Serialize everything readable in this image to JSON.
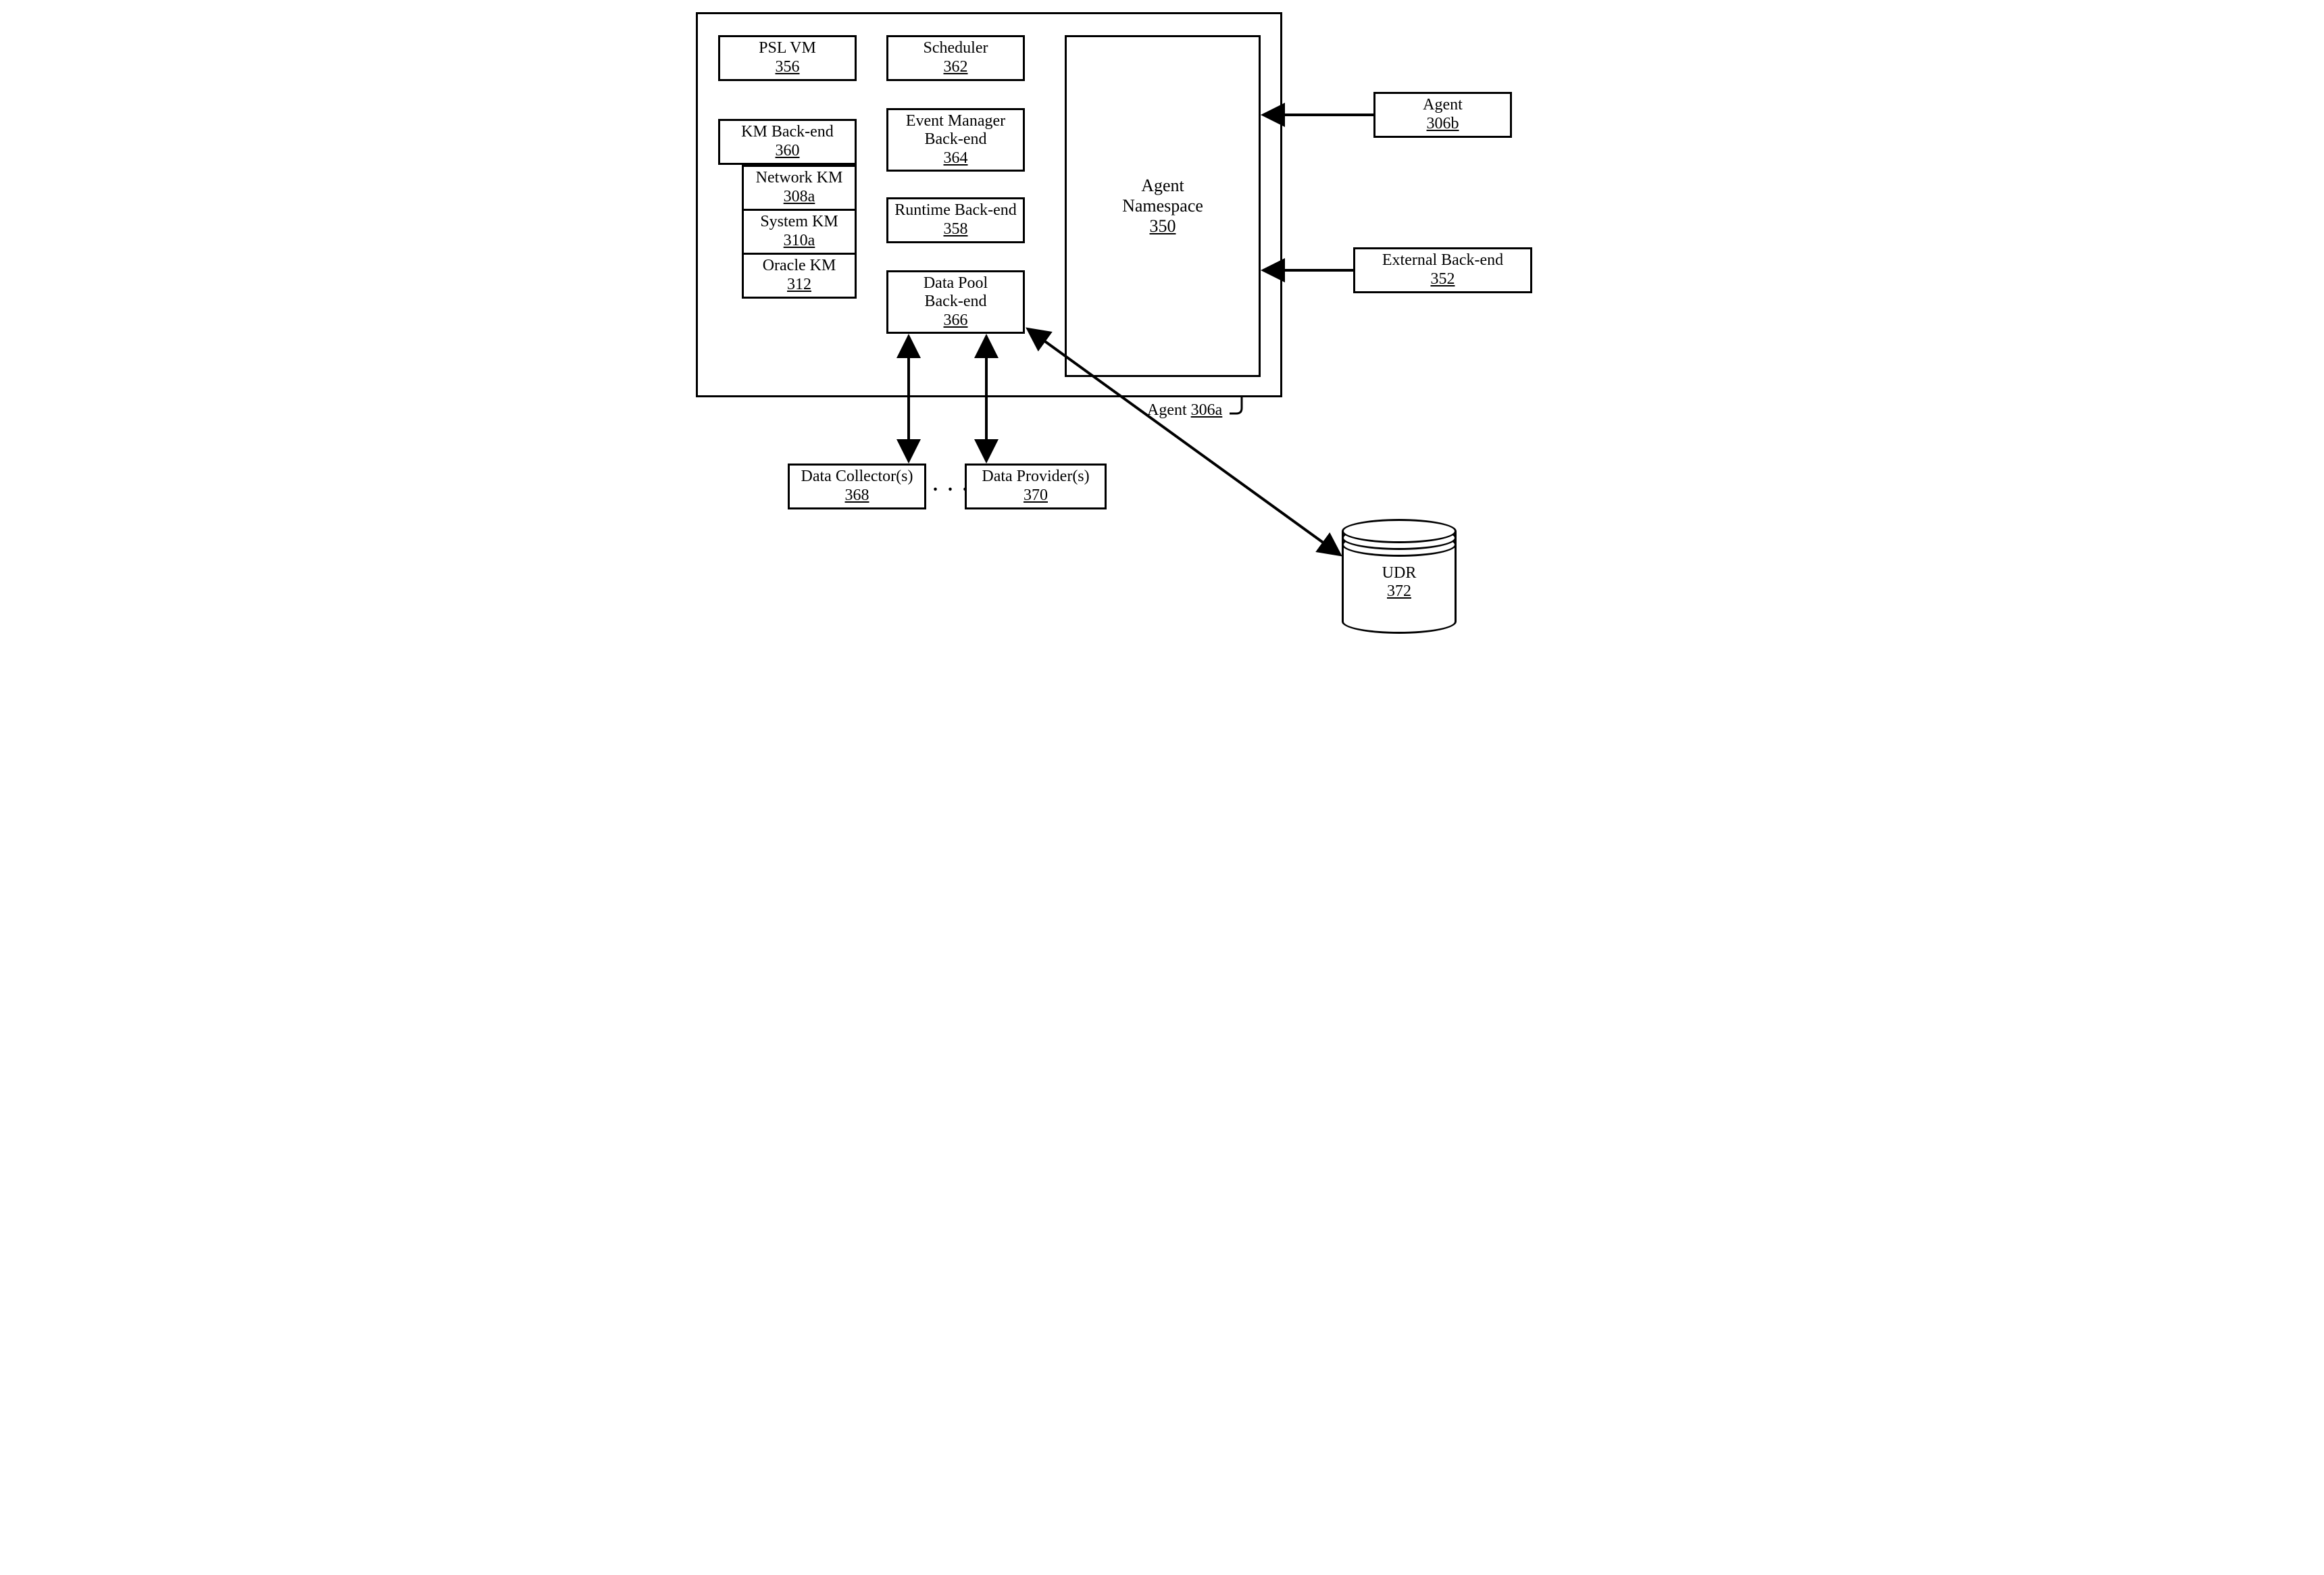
{
  "blocks": {
    "psl_vm": {
      "name": "PSL VM",
      "num": "356"
    },
    "km_backend": {
      "name": "KM Back-end",
      "num": "360"
    },
    "network_km": {
      "name": "Network KM",
      "num": "308a"
    },
    "system_km": {
      "name": "System KM",
      "num": "310a"
    },
    "oracle_km": {
      "name": "Oracle KM",
      "num": "312"
    },
    "scheduler": {
      "name": "Scheduler",
      "num": "362"
    },
    "event_mgr": {
      "name1": "Event Manager",
      "name2": "Back-end",
      "num": "364"
    },
    "runtime": {
      "name": "Runtime Back-end",
      "num": "358"
    },
    "data_pool": {
      "name1": "Data Pool",
      "name2": "Back-end",
      "num": "366"
    },
    "agent_ns": {
      "name1": "Agent",
      "name2": "Namespace",
      "num": "350"
    },
    "agent_ext": {
      "name": "Agent",
      "num": "306b"
    },
    "ext_backend": {
      "name": "External Back-end",
      "num": "352"
    },
    "data_coll": {
      "name": "Data Collector(s)",
      "num": "368"
    },
    "data_prov": {
      "name": "Data Provider(s)",
      "num": "370"
    },
    "udr": {
      "name": "UDR",
      "num": "372"
    }
  },
  "outer_label": {
    "prefix": "Agent ",
    "num": "306a"
  },
  "ellipsis": ". . ."
}
